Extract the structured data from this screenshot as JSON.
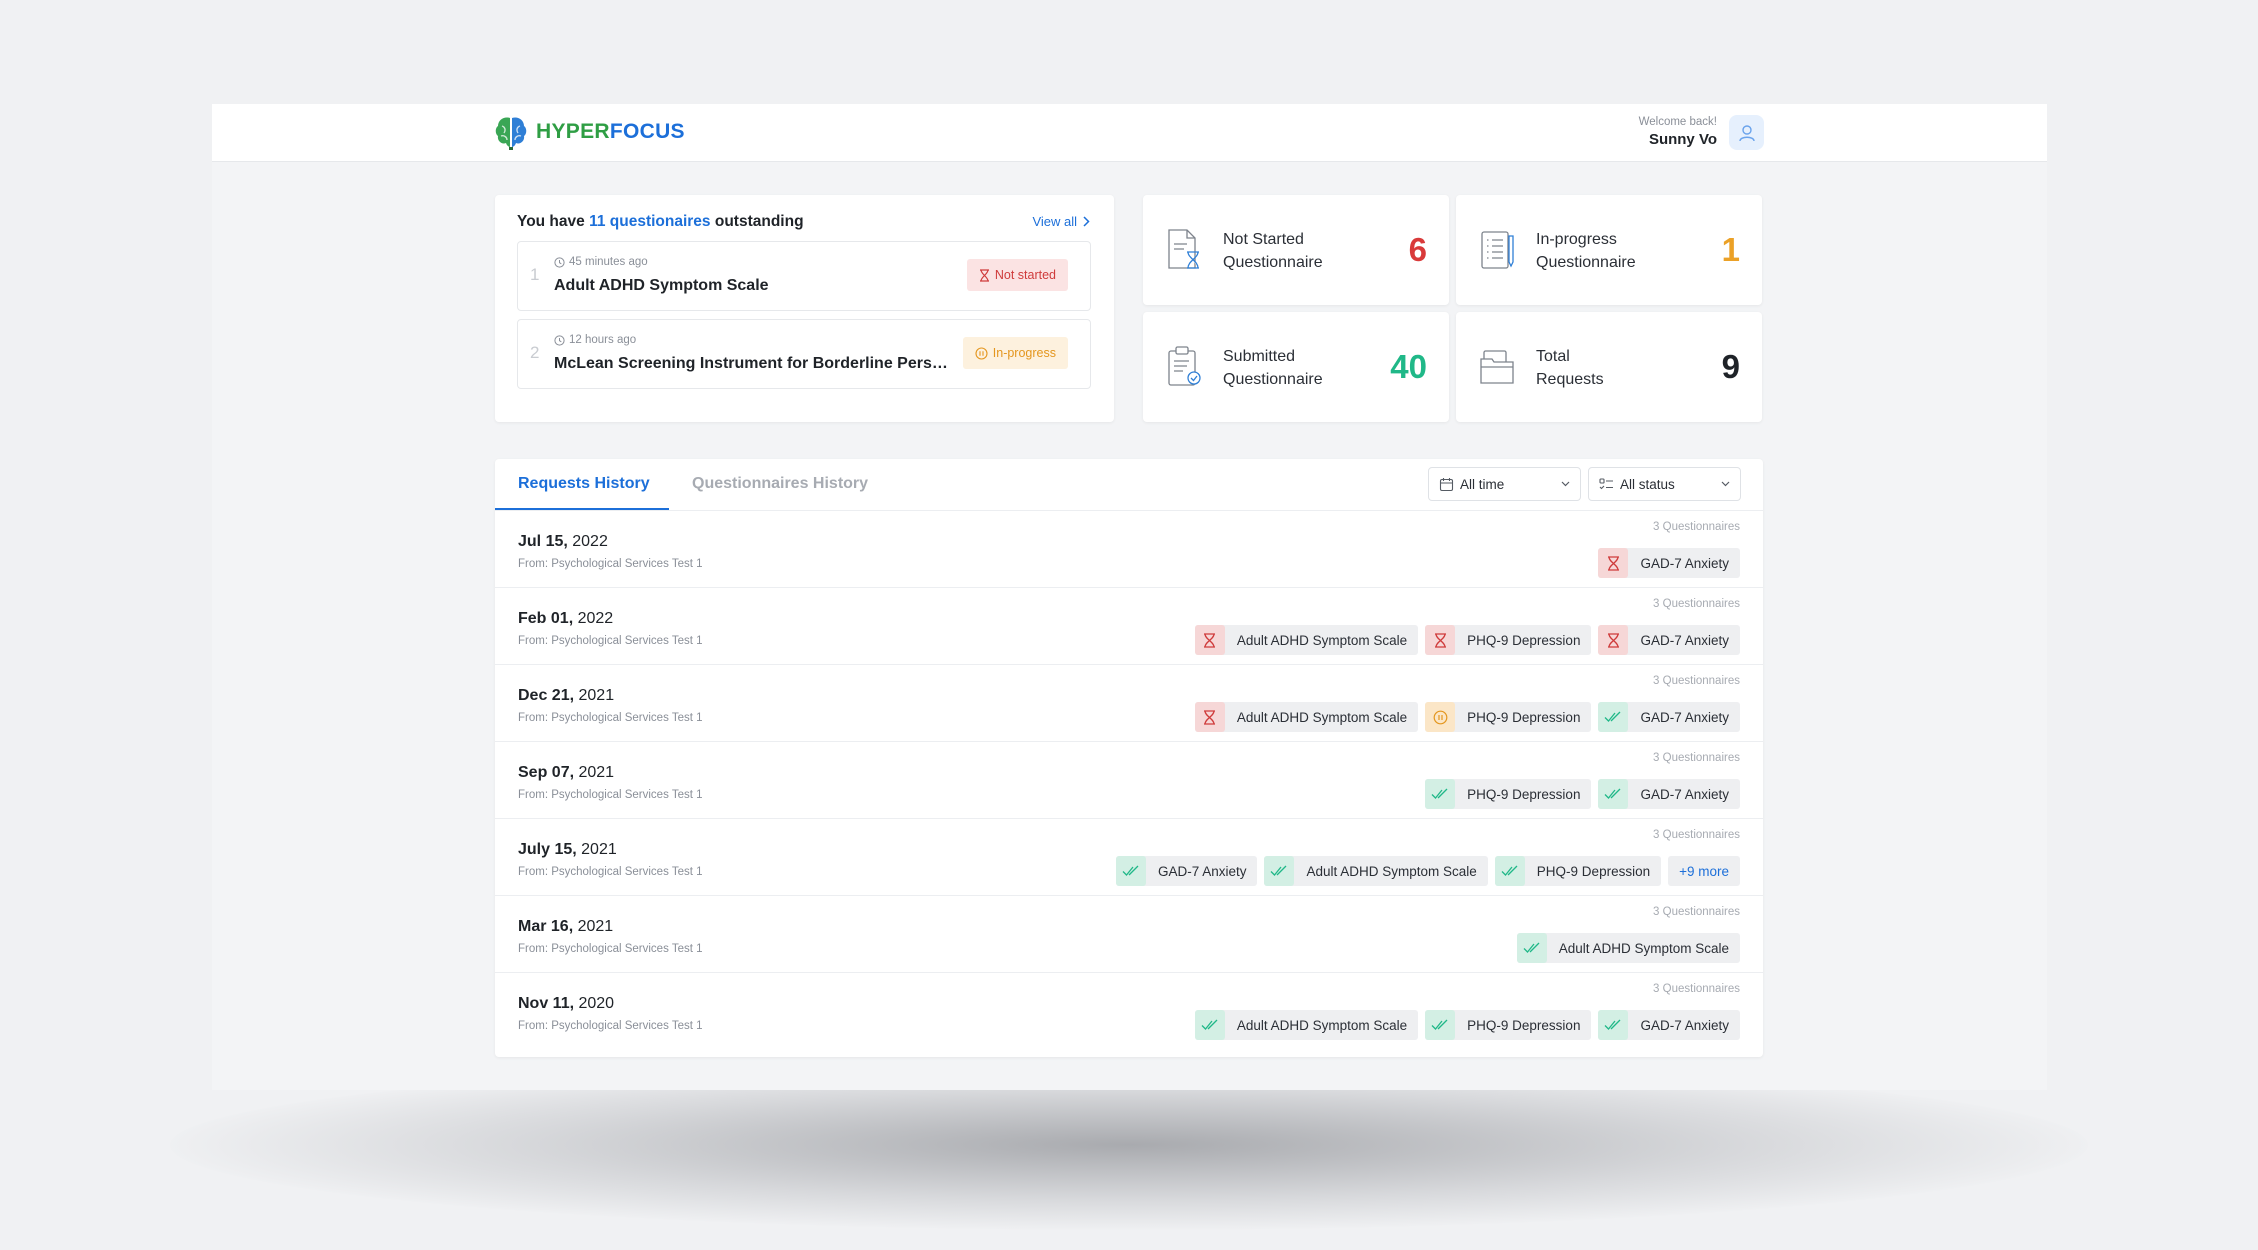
{
  "header": {
    "brand_part1": "HYPER",
    "brand_part2": "FOCUS",
    "welcome": "Welcome back!",
    "user_name": "Sunny Vo"
  },
  "outstanding": {
    "prefix": "You have ",
    "count_link": "11 questionaires",
    "suffix": " outstanding",
    "view_all": "View all",
    "items": [
      {
        "index": "1",
        "time": "45 minutes ago",
        "name": "Adult ADHD Symptom Scale",
        "status": "Not started"
      },
      {
        "index": "2",
        "time": "12 hours ago",
        "name": "McLean Screening Instrument for Borderline Personality Disorder",
        "status": "In-progress"
      }
    ]
  },
  "stats": [
    {
      "line1": "Not Started",
      "line2": "Questionnaire",
      "value": "6",
      "color": "#d93a3a"
    },
    {
      "line1": "In-progress",
      "line2": "Questionnaire",
      "value": "1",
      "color": "#eba127"
    },
    {
      "line1": "Submitted",
      "line2": "Questionnaire",
      "value": "40",
      "color": "#20b888"
    },
    {
      "line1": "Total",
      "line2": "Requests",
      "value": "9",
      "color": "#1f2328"
    }
  ],
  "history": {
    "tab_requests": "Requests History",
    "tab_questionnaires": "Questionnaires History",
    "filter_time": "All time",
    "filter_status": "All status",
    "rows": [
      {
        "date_bold": "Jul 15,",
        "year": " 2022",
        "from": "From: Psychological Services Test 1",
        "count": "3 Questionnaires",
        "chips": [
          {
            "label": "GAD-7 Anxiety",
            "status": "not-started"
          }
        ]
      },
      {
        "date_bold": "Feb 01,",
        "year": " 2022",
        "from": "From: Psychological Services Test 1",
        "count": "3 Questionnaires",
        "chips": [
          {
            "label": "Adult ADHD Symptom Scale",
            "status": "not-started"
          },
          {
            "label": "PHQ-9 Depression",
            "status": "not-started"
          },
          {
            "label": "GAD-7 Anxiety",
            "status": "not-started"
          }
        ]
      },
      {
        "date_bold": "Dec 21,",
        "year": " 2021",
        "from": "From: Psychological Services Test 1",
        "count": "3 Questionnaires",
        "chips": [
          {
            "label": "Adult ADHD Symptom Scale",
            "status": "not-started"
          },
          {
            "label": "PHQ-9 Depression",
            "status": "in-progress"
          },
          {
            "label": "GAD-7 Anxiety",
            "status": "submitted"
          }
        ]
      },
      {
        "date_bold": "Sep 07,",
        "year": " 2021",
        "from": "From: Psychological Services Test 1",
        "count": "3 Questionnaires",
        "chips": [
          {
            "label": "PHQ-9 Depression",
            "status": "submitted"
          },
          {
            "label": "GAD-7 Anxiety",
            "status": "submitted"
          }
        ]
      },
      {
        "date_bold": "July 15,",
        "year": " 2021",
        "from": "From: Psychological Services Test 1",
        "count": "3 Questionnaires",
        "chips": [
          {
            "label": "GAD-7 Anxiety",
            "status": "submitted"
          },
          {
            "label": "Adult ADHD Symptom Scale",
            "status": "submitted"
          },
          {
            "label": "PHQ-9 Depression",
            "status": "submitted"
          }
        ],
        "more": "+9 more"
      },
      {
        "date_bold": "Mar 16,",
        "year": " 2021",
        "from": "From: Psychological Services Test 1",
        "count": "3 Questionnaires",
        "chips": [
          {
            "label": "Adult ADHD Symptom Scale",
            "status": "submitted"
          }
        ]
      },
      {
        "date_bold": "Nov 11,",
        "year": " 2020",
        "from": "From: Psychological Services Test 1",
        "count": "3 Questionnaires",
        "chips": [
          {
            "label": "Adult ADHD Symptom Scale",
            "status": "submitted"
          },
          {
            "label": "PHQ-9 Depression",
            "status": "submitted"
          },
          {
            "label": "GAD-7 Anxiety",
            "status": "submitted"
          }
        ]
      }
    ]
  }
}
